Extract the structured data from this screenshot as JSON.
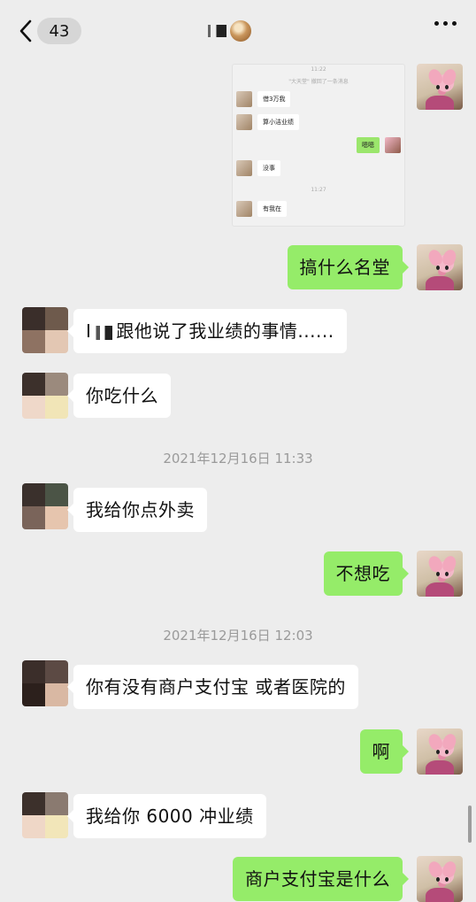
{
  "header": {
    "unread_count": "43",
    "title": ""
  },
  "screenshot": {
    "time1": "11:22",
    "recall_notice": "\"大天堂\" 撤回了一条消息",
    "msg1": "借3万我",
    "msg2": "算小洁业绩",
    "msg3": "嗯嗯",
    "msg4": "没事",
    "time2": "11:27",
    "msg5": "有我在"
  },
  "messages": {
    "m1": "搞什么名堂",
    "m2_prefix": "I",
    "m2_suffix": "跟他说了我业绩的事情......",
    "m3": "你吃什么",
    "ts1": "2021年12月16日 11:33",
    "m4": "我给你点外卖",
    "m5": "不想吃",
    "ts2": "2021年12月16日 12:03",
    "m6": "你有没有商户支付宝  或者医院的",
    "m7": "啊",
    "m8": "我给你 6000 冲业绩",
    "m9": "商户支付宝是什么"
  },
  "colors": {
    "background": "#ededed",
    "outgoing_bubble": "#95ec69",
    "incoming_bubble": "#ffffff"
  }
}
